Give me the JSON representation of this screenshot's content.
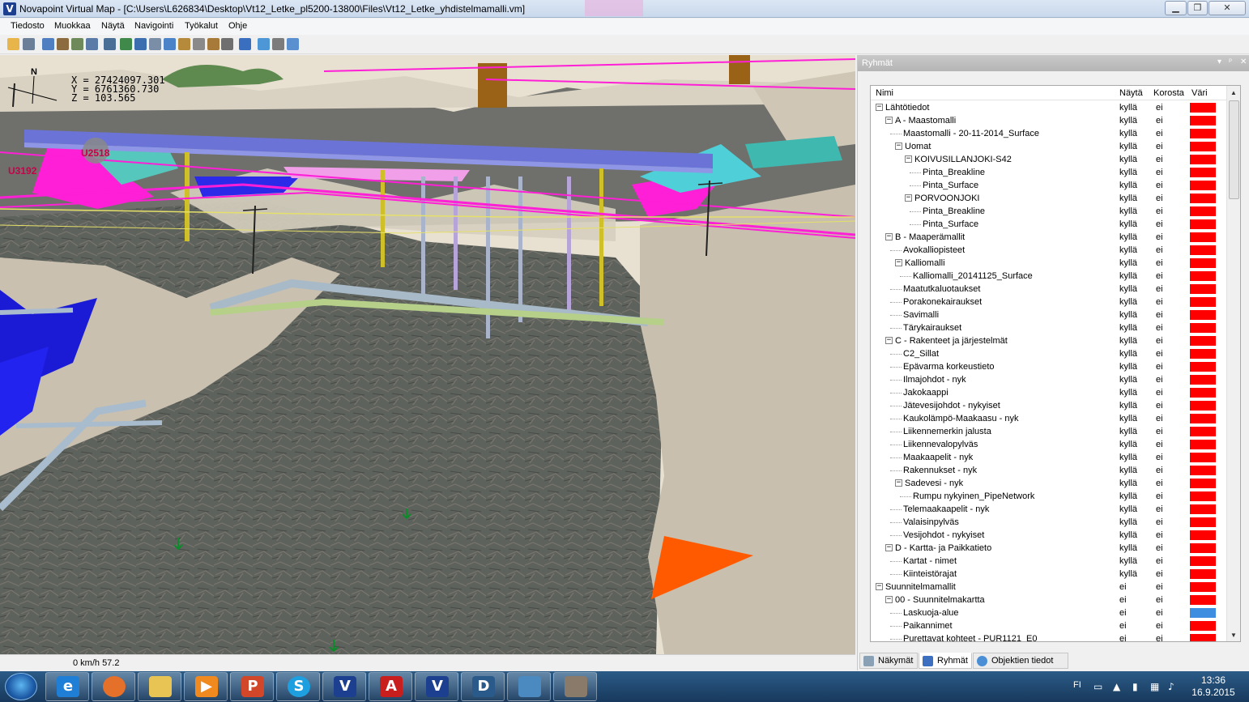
{
  "window": {
    "title": "Novapoint Virtual Map - [C:\\Users\\L626834\\Desktop\\Vt12_Letke_pl5200-13800\\Files\\Vt12_Letke_yhdistelmamalli.vm]",
    "app_icon": "V"
  },
  "menu": [
    "Tiedosto",
    "Muokkaa",
    "Näytä",
    "Navigointi",
    "Työkalut",
    "Ohje"
  ],
  "viewport": {
    "coords": [
      "X = 27424097.301",
      "Y = 6761360.730",
      "Z = 103.565"
    ],
    "north_label": "N",
    "labels": [
      "U2518",
      "U3192"
    ]
  },
  "status": {
    "speed": "0 km/h  57.2"
  },
  "panel": {
    "title": "Ryhmät",
    "columns": {
      "name": "Nimi",
      "show": "Näytä",
      "highlight": "Korosta",
      "color": "Väri"
    },
    "rows": [
      {
        "label": "Lähtötiedot",
        "show": "kyllä",
        "hl": "ei",
        "color": "#ff0000"
      },
      {
        "label": "A - Maastomalli",
        "show": "kyllä",
        "hl": "ei",
        "color": "#ff0000"
      },
      {
        "label": "Maastomalli - 20-11-2014_Surface",
        "show": "kyllä",
        "hl": "ei",
        "color": "#ff0000"
      },
      {
        "label": "Uomat",
        "show": "kyllä",
        "hl": "ei",
        "color": "#ff0000"
      },
      {
        "label": "KOIVUSILLANJOKI-S42",
        "show": "kyllä",
        "hl": "ei",
        "color": "#ff0000"
      },
      {
        "label": "Pinta_Breakline",
        "show": "kyllä",
        "hl": "ei",
        "color": "#ff0000"
      },
      {
        "label": "Pinta_Surface",
        "show": "kyllä",
        "hl": "ei",
        "color": "#ff0000"
      },
      {
        "label": "PORVOONJOKI",
        "show": "kyllä",
        "hl": "ei",
        "color": "#ff0000"
      },
      {
        "label": "Pinta_Breakline",
        "show": "kyllä",
        "hl": "ei",
        "color": "#ff0000"
      },
      {
        "label": "Pinta_Surface",
        "show": "kyllä",
        "hl": "ei",
        "color": "#ff0000"
      },
      {
        "label": "B - Maaperämallit",
        "show": "kyllä",
        "hl": "ei",
        "color": "#ff0000"
      },
      {
        "label": "Avokalliopisteet",
        "show": "kyllä",
        "hl": "ei",
        "color": "#ff0000"
      },
      {
        "label": "Kalliomalli",
        "show": "kyllä",
        "hl": "ei",
        "color": "#ff0000"
      },
      {
        "label": "Kalliomalli_20141125_Surface",
        "show": "kyllä",
        "hl": "ei",
        "color": "#ff0000"
      },
      {
        "label": "Maatutkaluotaukset",
        "show": "kyllä",
        "hl": "ei",
        "color": "#ff0000"
      },
      {
        "label": "Porakonekairaukset",
        "show": "kyllä",
        "hl": "ei",
        "color": "#ff0000"
      },
      {
        "label": "Savimalli",
        "show": "kyllä",
        "hl": "ei",
        "color": "#ff0000"
      },
      {
        "label": "Tärykairaukset",
        "show": "kyllä",
        "hl": "ei",
        "color": "#ff0000"
      },
      {
        "label": "C - Rakenteet ja järjestelmät",
        "show": "kyllä",
        "hl": "ei",
        "color": "#ff0000"
      },
      {
        "label": "C2_Sillat",
        "show": "kyllä",
        "hl": "ei",
        "color": "#ff0000"
      },
      {
        "label": "Epävarma korkeustieto",
        "show": "kyllä",
        "hl": "ei",
        "color": "#ff0000"
      },
      {
        "label": "Ilmajohdot - nyk",
        "show": "kyllä",
        "hl": "ei",
        "color": "#ff0000"
      },
      {
        "label": "Jakokaappi",
        "show": "kyllä",
        "hl": "ei",
        "color": "#ff0000"
      },
      {
        "label": "Jätevesijohdot - nykyiset",
        "show": "kyllä",
        "hl": "ei",
        "color": "#ff0000"
      },
      {
        "label": "Kaukolämpö-Maakaasu - nyk",
        "show": "kyllä",
        "hl": "ei",
        "color": "#ff0000"
      },
      {
        "label": "Liikennemerkin jalusta",
        "show": "kyllä",
        "hl": "ei",
        "color": "#ff0000"
      },
      {
        "label": "Liikennevalopylväs",
        "show": "kyllä",
        "hl": "ei",
        "color": "#ff0000"
      },
      {
        "label": "Maakaapelit - nyk",
        "show": "kyllä",
        "hl": "ei",
        "color": "#ff0000"
      },
      {
        "label": "Rakennukset - nyk",
        "show": "kyllä",
        "hl": "ei",
        "color": "#ff0000"
      },
      {
        "label": "Sadevesi - nyk",
        "show": "kyllä",
        "hl": "ei",
        "color": "#ff0000"
      },
      {
        "label": "Rumpu nykyinen_PipeNetwork",
        "show": "kyllä",
        "hl": "ei",
        "color": "#ff0000"
      },
      {
        "label": "Telemaakaapelit - nyk",
        "show": "kyllä",
        "hl": "ei",
        "color": "#ff0000"
      },
      {
        "label": "Valaisinpylväs",
        "show": "kyllä",
        "hl": "ei",
        "color": "#ff0000"
      },
      {
        "label": "Vesijohdot - nykyiset",
        "show": "kyllä",
        "hl": "ei",
        "color": "#ff0000"
      },
      {
        "label": "D - Kartta- ja Paikkatieto",
        "show": "kyllä",
        "hl": "ei",
        "color": "#ff0000"
      },
      {
        "label": "Kartat - nimet",
        "show": "kyllä",
        "hl": "ei",
        "color": "#ff0000"
      },
      {
        "label": "Kiinteistörajat",
        "show": "kyllä",
        "hl": "ei",
        "color": "#ff0000"
      },
      {
        "label": "Suunnitelmamallit",
        "show": "ei",
        "hl": "ei",
        "color": "#ff0000"
      },
      {
        "label": "00 - Suunnitelmakartta",
        "show": "ei",
        "hl": "ei",
        "color": "#ff0000"
      },
      {
        "label": "Laskuoja-alue",
        "show": "ei",
        "hl": "ei",
        "color": "#3d8ee0"
      },
      {
        "label": "Paikannimet",
        "show": "ei",
        "hl": "ei",
        "color": "#ff0000"
      },
      {
        "label": "Purettavat kohteet - PUR1121_E0",
        "show": "ei",
        "hl": "ei",
        "color": "#ff0000"
      }
    ],
    "tabs": [
      "Näkymät",
      "Ryhmät",
      "Objektien tiedot"
    ]
  },
  "tray": {
    "lang": "FI",
    "time": "13:36",
    "date": "16.9.2015"
  }
}
